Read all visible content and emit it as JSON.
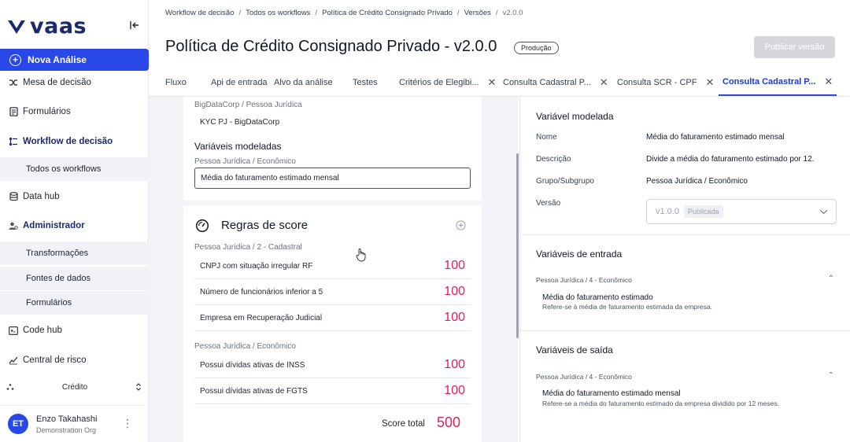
{
  "sidebar": {
    "logo": "vaas",
    "new_analysis": "Nova Análise",
    "items": {
      "mesa": "Mesa de decisão",
      "formularios": "Formulários",
      "workflow": "Workflow de decisão",
      "todos_workflows": "Todos os workflows",
      "datahub": "Data hub",
      "admin": "Administrador",
      "transformacoes": "Transformações",
      "fontes": "Fontes de dados",
      "formularios_admin": "Formulários",
      "codehub": "Code hub",
      "risco": "Central de risco"
    },
    "org_select": "Crédito",
    "user": {
      "initials": "ET",
      "name": "Enzo Takahashi",
      "org": "Demonstration Org"
    }
  },
  "breadcrumb": {
    "items": [
      "Workflow de decisão",
      "Todos os workflows",
      "Política de Crédito Consignado Privado",
      "Versões"
    ],
    "current": "v2.0.0"
  },
  "header": {
    "title": "Política de Crédito Consignado Privado - v2.0.0",
    "env_badge": "Produção",
    "publish": "Publicar versão"
  },
  "tabs": [
    "Fluxo",
    "Api de entrada",
    "Alvo da análise",
    "Testes",
    "Critérios de Elegibi...",
    "Consulta Cadastral P...",
    "Consulta SCR - CPF",
    "Consulta Cadastral P..."
  ],
  "left": {
    "source_group": "BigDataCorp / Pessoa Jurídica",
    "source_name": "KYC PJ - BigDataCorp",
    "modeled_title": "Variáveis modeladas",
    "modeled_group": "Pessoa Jurídica / Econômico",
    "modeled_value": "Média do faturamento estimado mensal",
    "rules_title": "Regras de score",
    "group1": "Pessoa Jurídica / 2 - Cadastral",
    "group2": "Pessoa Jurídica / Econômico",
    "rules1": [
      {
        "label": "CNPJ com situação irregular RF",
        "score": "100"
      },
      {
        "label": "Número de funcionários inferior a 5",
        "score": "100"
      },
      {
        "label": "Empresa em Recuperação Judicial",
        "score": "100"
      }
    ],
    "rules2": [
      {
        "label": "Possui dívidas ativas de INSS",
        "score": "100"
      },
      {
        "label": "Possui dívidas ativas de FGTS",
        "score": "100"
      }
    ],
    "total_label": "Score total",
    "total_value": "500"
  },
  "right": {
    "title": "Variável modelada",
    "fields": {
      "nome_label": "Nome",
      "nome_value": "Média do faturamento estimado mensal",
      "desc_label": "Descrição",
      "desc_value": "Divide a média do faturamento estimado por 12.",
      "grupo_label": "Grupo/Subgrupo",
      "grupo_value": "Pessoa Jurídica / Econômico",
      "versao_label": "Versão",
      "versao_value": "v1.0.0",
      "versao_status": "Publicada"
    },
    "inputs_title": "Variáveis de entrada",
    "inputs_group": "Pessoa Jurídica / 4 - Econômico",
    "input_name": "Média do faturamento estimado",
    "input_desc": "Refere-se à média de faturamento estimada da empresa.",
    "outputs_title": "Variáveis de saída",
    "outputs_group": "Pessoa Jurídica / 4 - Econômico",
    "output_name": "Média do faturamento estimado mensal",
    "output_desc": "Refere-se a média do faturamento estimado da empresa dividido por 12 meses."
  }
}
